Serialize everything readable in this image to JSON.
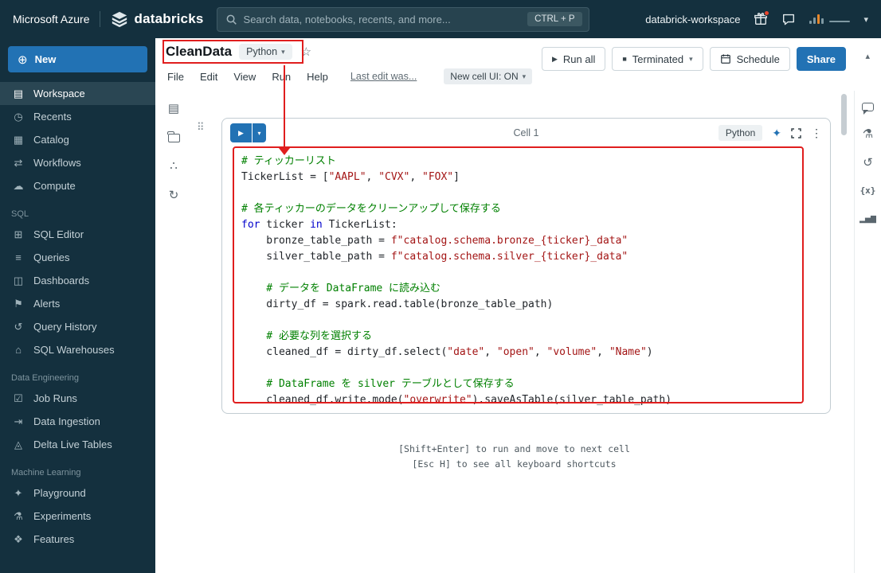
{
  "colors": {
    "topbar_bg": "#14303e",
    "accent": "#2272b4",
    "annotation_red": "#e01e1e",
    "comment": "#008000",
    "keyword": "#0000cc",
    "string": "#a31515",
    "code_default": "#1f2328"
  },
  "icons": {
    "plus": "⊕",
    "star": "☆",
    "chevron_down": "▾",
    "chevron_up": "▴",
    "play": "▶",
    "stop": "■",
    "kebab": "⋮",
    "drag_handle": "⠿",
    "sparkle": "✦"
  },
  "topbar": {
    "azure_label": "Microsoft Azure",
    "brand": "databricks",
    "search_placeholder": "Search data, notebooks, recents, and more...",
    "search_shortcut": "CTRL + P",
    "workspace_name": "databrick-workspace"
  },
  "sidebar": {
    "new_label": "New",
    "sections": [
      {
        "header": null,
        "items": [
          {
            "label": "Workspace",
            "icon": "workspace-icon",
            "glyph": "▤",
            "active": true
          },
          {
            "label": "Recents",
            "icon": "recents-icon",
            "glyph": "◷",
            "active": false
          },
          {
            "label": "Catalog",
            "icon": "catalog-icon",
            "glyph": "▦",
            "active": false
          },
          {
            "label": "Workflows",
            "icon": "workflows-icon",
            "glyph": "⇄",
            "active": false
          },
          {
            "label": "Compute",
            "icon": "compute-icon",
            "glyph": "☁",
            "active": false
          }
        ]
      },
      {
        "header": "SQL",
        "items": [
          {
            "label": "SQL Editor",
            "icon": "sql-editor-icon",
            "glyph": "⊞",
            "active": false
          },
          {
            "label": "Queries",
            "icon": "queries-icon",
            "glyph": "≡",
            "active": false
          },
          {
            "label": "Dashboards",
            "icon": "dashboards-icon",
            "glyph": "◫",
            "active": false
          },
          {
            "label": "Alerts",
            "icon": "alerts-icon",
            "glyph": "⚑",
            "active": false
          },
          {
            "label": "Query History",
            "icon": "query-history-icon",
            "glyph": "↺",
            "active": false
          },
          {
            "label": "SQL Warehouses",
            "icon": "sql-warehouses-icon",
            "glyph": "⌂",
            "active": false
          }
        ]
      },
      {
        "header": "Data Engineering",
        "items": [
          {
            "label": "Job Runs",
            "icon": "job-runs-icon",
            "glyph": "☑",
            "active": false
          },
          {
            "label": "Data Ingestion",
            "icon": "data-ingestion-icon",
            "glyph": "⇥",
            "active": false
          },
          {
            "label": "Delta Live Tables",
            "icon": "delta-live-tables-icon",
            "glyph": "◬",
            "active": false
          }
        ]
      },
      {
        "header": "Machine Learning",
        "items": [
          {
            "label": "Playground",
            "icon": "playground-icon",
            "glyph": "✦",
            "active": false
          },
          {
            "label": "Experiments",
            "icon": "experiments-icon",
            "glyph": "⚗",
            "active": false
          },
          {
            "label": "Features",
            "icon": "features-icon",
            "glyph": "❖",
            "active": false
          }
        ]
      }
    ]
  },
  "notebook": {
    "title": "CleanData",
    "language": "Python",
    "menu": [
      "File",
      "Edit",
      "View",
      "Run",
      "Help"
    ],
    "last_edit": "Last edit was...",
    "cell_ui": "New cell UI: ON",
    "run_all": "Run all",
    "state": "Terminated",
    "schedule": "Schedule",
    "share": "Share"
  },
  "left_rail": {
    "icons": [
      {
        "name": "table-of-contents-icon",
        "glyph": "▤"
      },
      {
        "name": "folder-icon",
        "glyph": ""
      },
      {
        "name": "catalog-tree-icon",
        "glyph": "∴"
      },
      {
        "name": "run-history-icon",
        "glyph": "↻"
      }
    ]
  },
  "right_rail": {
    "icons": [
      {
        "name": "comments-icon",
        "glyph": ""
      },
      {
        "name": "experiment-icon",
        "glyph": "⚗"
      },
      {
        "name": "version-history-icon",
        "glyph": "↺"
      },
      {
        "name": "variables-icon",
        "glyph": "{x}"
      },
      {
        "name": "data-profile-icon",
        "glyph": "▂▅▇"
      }
    ]
  },
  "cell": {
    "title": "Cell 1",
    "language_badge": "Python",
    "code_lines": [
      {
        "tokens": [
          {
            "s": "# ティッカーリスト",
            "c": "comment"
          }
        ]
      },
      {
        "tokens": [
          {
            "s": "TickerList = ["
          },
          {
            "s": "\"AAPL\"",
            "c": "string"
          },
          {
            "s": ", "
          },
          {
            "s": "\"CVX\"",
            "c": "string"
          },
          {
            "s": ", "
          },
          {
            "s": "\"FOX\"",
            "c": "string"
          },
          {
            "s": "]"
          }
        ]
      },
      {
        "tokens": []
      },
      {
        "tokens": [
          {
            "s": "# 各ティッカーのデータをクリーンアップして保存する",
            "c": "comment"
          }
        ]
      },
      {
        "tokens": [
          {
            "s": "for",
            "c": "keyword"
          },
          {
            "s": " ticker "
          },
          {
            "s": "in",
            "c": "keyword"
          },
          {
            "s": " TickerList:"
          }
        ]
      },
      {
        "tokens": [
          {
            "s": "    bronze_table_path = "
          },
          {
            "s": "f\"catalog.schema.bronze_{ticker}_data\"",
            "c": "string"
          }
        ]
      },
      {
        "tokens": [
          {
            "s": "    silver_table_path = "
          },
          {
            "s": "f\"catalog.schema.silver_{ticker}_data\"",
            "c": "string"
          }
        ]
      },
      {
        "tokens": []
      },
      {
        "tokens": [
          {
            "s": "    # データを DataFrame に読み込む",
            "c": "comment"
          }
        ]
      },
      {
        "tokens": [
          {
            "s": "    dirty_df = spark.read.table(bronze_table_path)"
          }
        ]
      },
      {
        "tokens": []
      },
      {
        "tokens": [
          {
            "s": "    # 必要な列を選択する",
            "c": "comment"
          }
        ]
      },
      {
        "tokens": [
          {
            "s": "    cleaned_df = dirty_df.select("
          },
          {
            "s": "\"date\"",
            "c": "string"
          },
          {
            "s": ", "
          },
          {
            "s": "\"open\"",
            "c": "string"
          },
          {
            "s": ", "
          },
          {
            "s": "\"volume\"",
            "c": "string"
          },
          {
            "s": ", "
          },
          {
            "s": "\"Name\"",
            "c": "string"
          },
          {
            "s": ")"
          }
        ]
      },
      {
        "tokens": []
      },
      {
        "tokens": [
          {
            "s": "    # DataFrame を silver テーブルとして保存する",
            "c": "comment"
          }
        ]
      },
      {
        "tokens": [
          {
            "s": "    cleaned_df.write.mode("
          },
          {
            "s": "\"overwrite\"",
            "c": "string"
          },
          {
            "s": ").saveAsTable(silver_table_path)"
          }
        ]
      }
    ]
  },
  "hints": [
    "[Shift+Enter] to run and move to next cell",
    "[Esc H] to see all keyboard shortcuts"
  ]
}
